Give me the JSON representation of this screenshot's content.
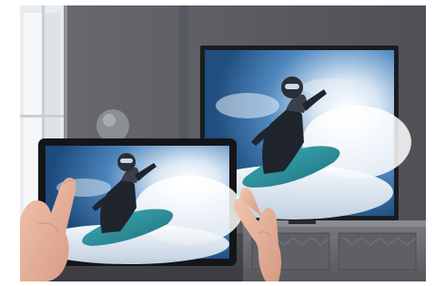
{
  "photo": {
    "subject": "tablet-mirroring-to-tv",
    "palette": {
      "wall": "#5d5f66",
      "wall_dark": "#4b4d53",
      "window_light": "#eef0f2",
      "tv_bezel": "#1b1c1f",
      "sky_blue": "#2f6aa3",
      "snow_white": "#f3f6f8",
      "board_teal": "#2a8f9b",
      "rider_dark": "#20242c",
      "skin": "#e7b6a0",
      "cabinet": "#6d6f74"
    }
  }
}
